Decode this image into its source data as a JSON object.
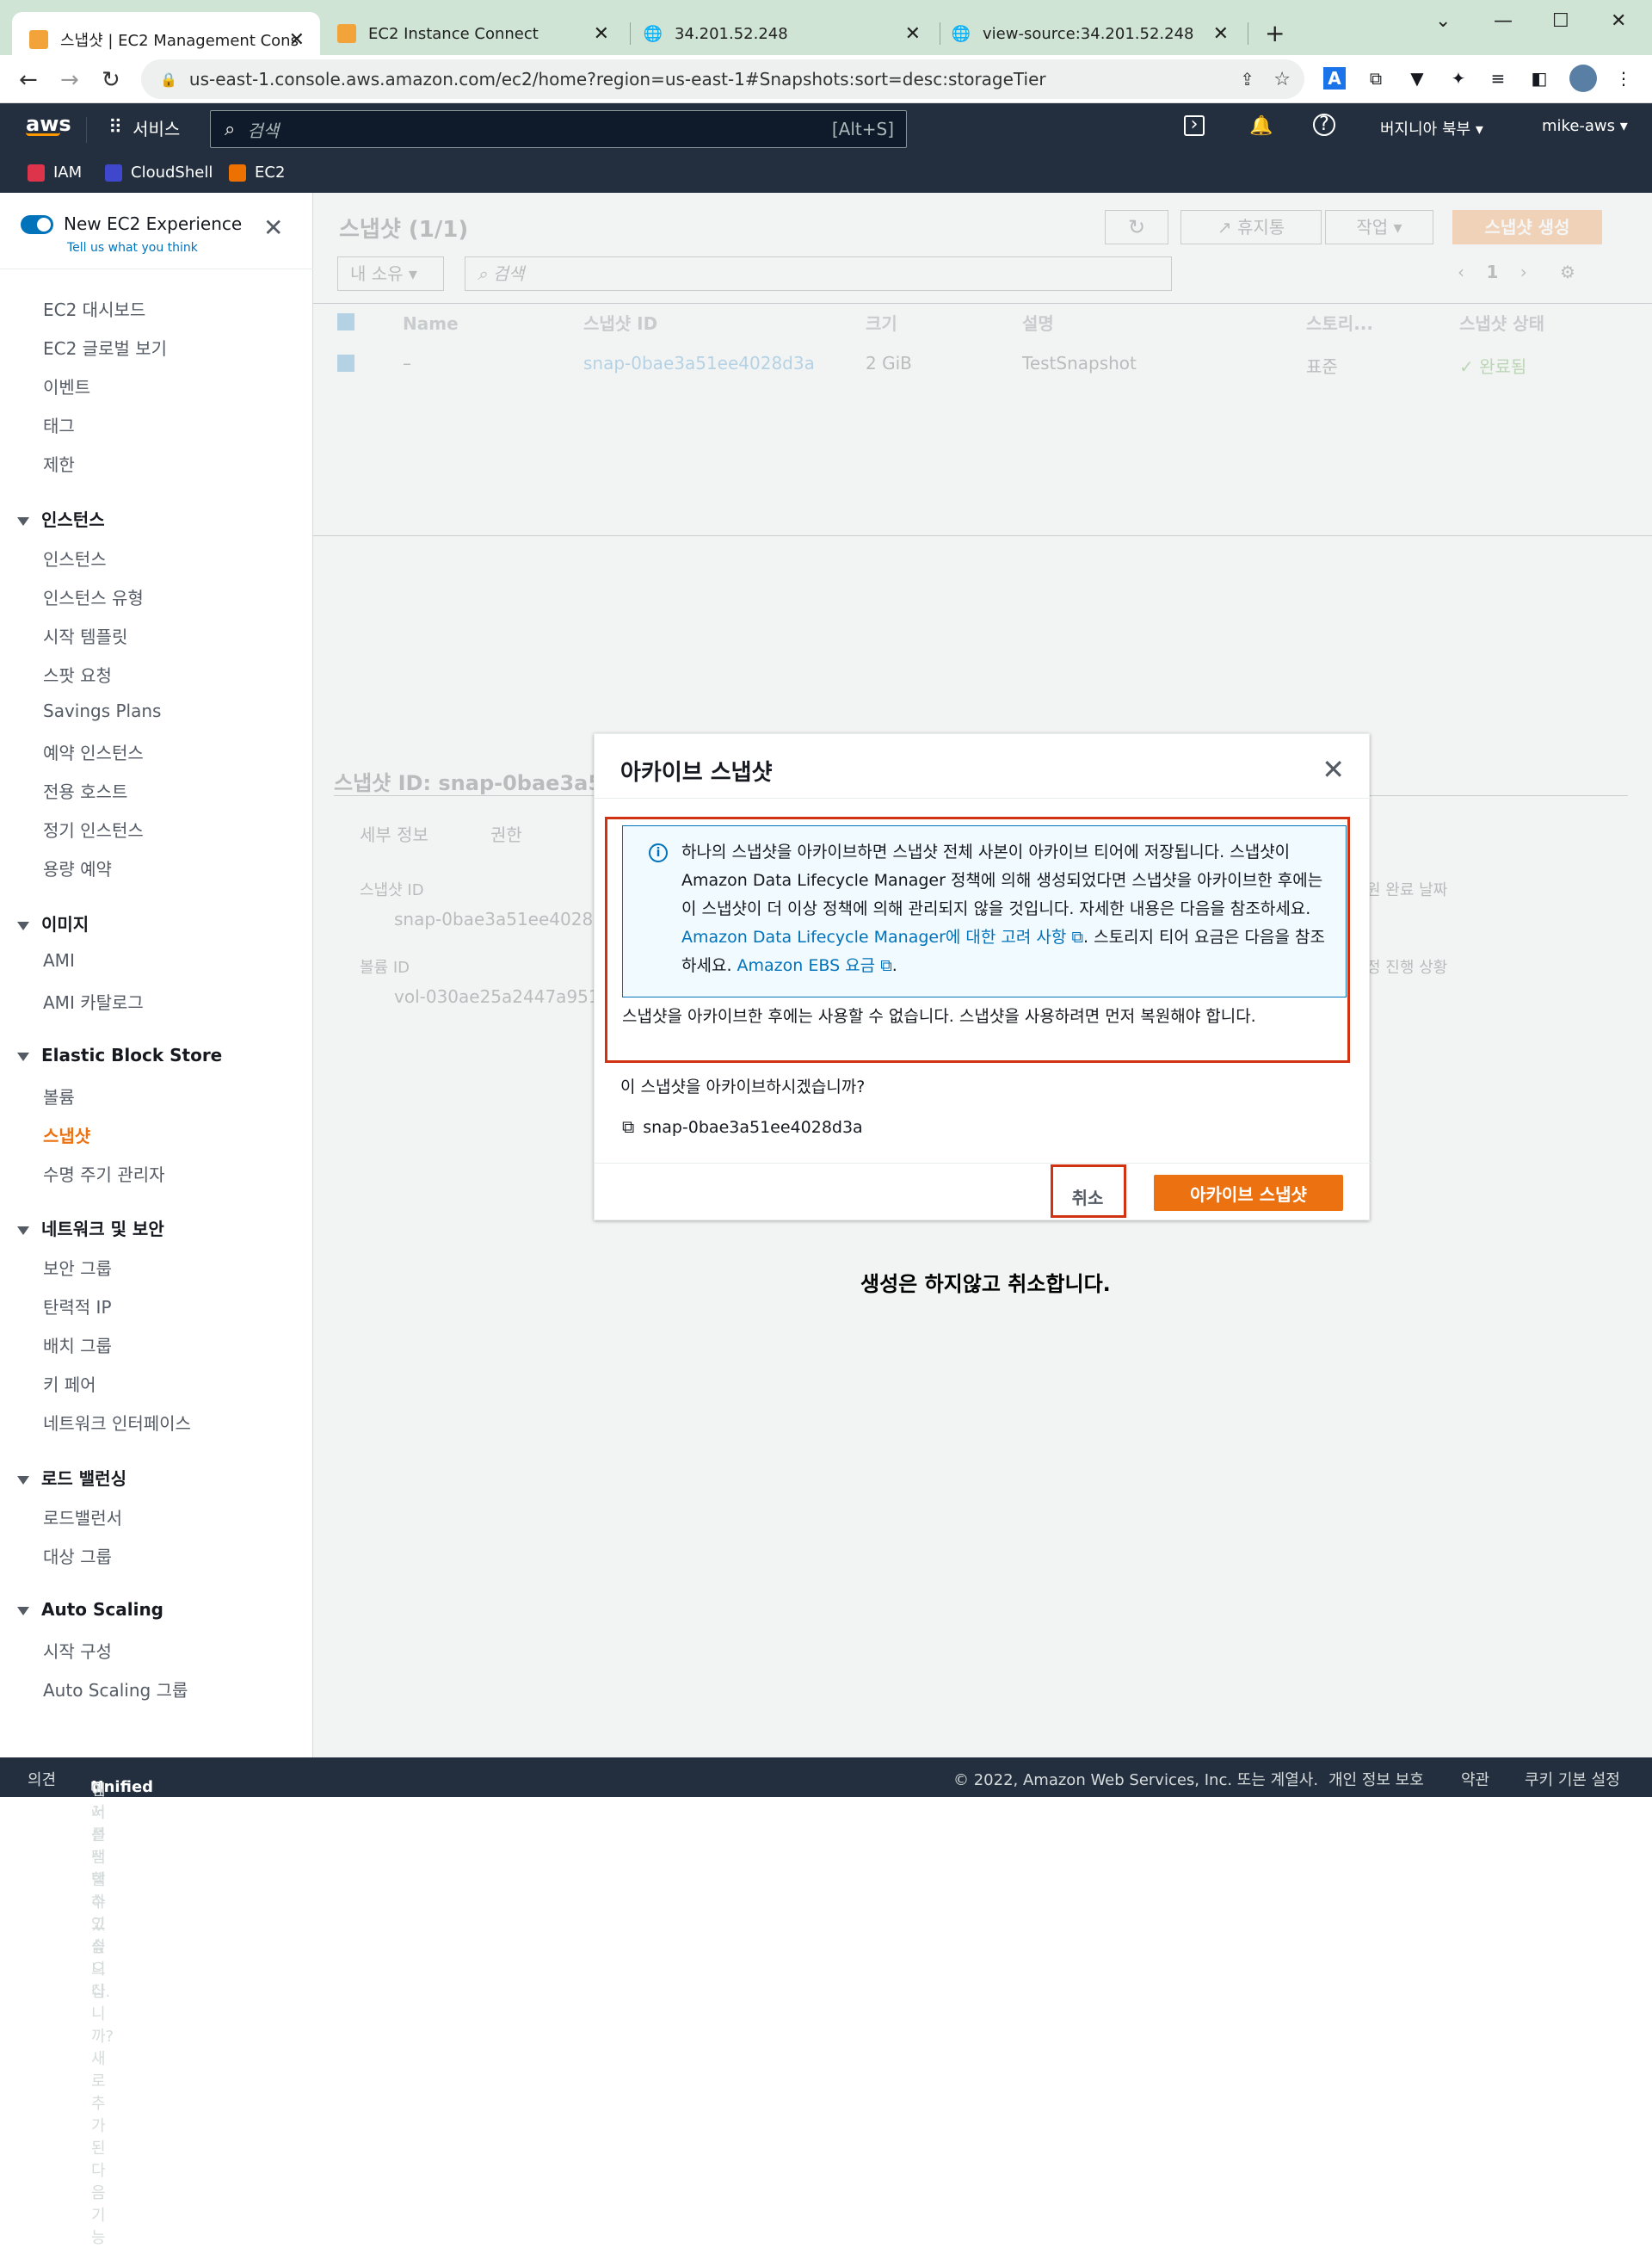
{
  "browser": {
    "tabs": [
      {
        "title": "스냅샷 | EC2 Management Cons",
        "active": true
      },
      {
        "title": "EC2 Instance Connect",
        "active": false
      },
      {
        "title": "34.201.52.248",
        "active": false
      },
      {
        "title": "view-source:34.201.52.248",
        "active": false
      }
    ],
    "url": "us-east-1.console.aws.amazon.com/ec2/home?region=us-east-1#Snapshots:sort=desc:storageTier"
  },
  "awsbar": {
    "logo": "aws",
    "services": "서비스",
    "search_placeholder": "검색",
    "search_shortcut": "[Alt+S]",
    "region": "버지니아 북부",
    "user": "mike-aws",
    "favorites": [
      "IAM",
      "CloudShell",
      "EC2"
    ]
  },
  "sidebar": {
    "new_exp_title": "New EC2 Experience",
    "new_exp_sub": "Tell us what you think",
    "top_items": [
      "EC2 대시보드",
      "EC2 글로벌 보기",
      "이벤트",
      "태그",
      "제한"
    ],
    "sections": [
      {
        "title": "인스턴스",
        "items": [
          "인스턴스",
          "인스턴스 유형",
          "시작 템플릿",
          "스팟 요청",
          "Savings Plans",
          "예약 인스턴스",
          "전용 호스트",
          "정기 인스턴스",
          "용량 예약"
        ]
      },
      {
        "title": "이미지",
        "items": [
          "AMI",
          "AMI 카탈로그"
        ]
      },
      {
        "title": "Elastic Block Store",
        "items": [
          "볼륨",
          "스냅샷",
          "수명 주기 관리자"
        ]
      },
      {
        "title": "네트워크 및 보안",
        "items": [
          "보안 그룹",
          "탄력적 IP",
          "배치 그룹",
          "키 페어",
          "네트워크 인터페이스"
        ]
      },
      {
        "title": "로드 밸런싱",
        "items": [
          "로드밸런서",
          "대상 그룹"
        ]
      },
      {
        "title": "Auto Scaling",
        "items": [
          "시작 구성",
          "Auto Scaling 그룹"
        ]
      }
    ],
    "active_item": "스냅샷"
  },
  "main": {
    "title": "스냅샷 (1/1)",
    "recycle_bin": "휴지통",
    "actions": "작업",
    "create": "스냅샷 생성",
    "filter_owner": "내 소유",
    "search_placeholder": "검색",
    "page": "1",
    "columns": [
      "Name",
      "스냅샷 ID",
      "크기",
      "설명",
      "스토리...",
      "스냅샷 상태"
    ],
    "row": [
      "–",
      "snap-0bae3a51ee4028d3a",
      "2 GiB",
      "TestSnapshot",
      "표준",
      "완료됨"
    ],
    "detail_title": "스냅샷 ID: snap-0bae3a51e",
    "detail_tabs": [
      "세부 정보",
      "권한"
    ],
    "detail_labels": [
      "스냅샷 ID",
      "볼륨 ID"
    ],
    "detail_values": [
      "snap-0bae3a51ee4028d",
      "vol-030ae25a2447a951"
    ],
    "detail_right": [
      "원 완료 날짜",
      "정 진행 상황"
    ]
  },
  "modal": {
    "title": "아카이브 스냅샷",
    "info_part1": "하나의 스냅샷을 아카이브하면 스냅샷 전체 사본이 아카이브 티어에 저장됩니다. 스냅샷이 Amazon Data Lifecycle Manager 정책에 의해 생성되었다면 스냅샷을 아카이브한 후에는 이 스냅샷이 더 이상 정책에 의해 관리되지 않을 것입니다. 자세한 내용은 다음을 참조하세요.",
    "info_link1": "Amazon Data Lifecycle Manager에 대한 고려 사항",
    "info_part2": ". 스토리지 티어 요금은 다음을 참조하세요.",
    "info_link2": "Amazon EBS 요금",
    "info_end": ".",
    "warning": "스냅샷을 아카이브한 후에는 사용할 수 없습니다. 스냅샷을 사용하려면 먼저 복원해야 합니다.",
    "question": "이 스냅샷을 아카이브하시겠습니까?",
    "snapshot_id": "snap-0bae3a51ee4028d3a",
    "cancel": "취소",
    "confirm": "아카이브 스냅샷"
  },
  "caption": "생성은 하지않고 취소합니다.",
  "footer": {
    "feedback": "의견",
    "lang_prefix": "언어를 선택하고 싶으십니까? 새로 추가된 다음 기능",
    "lang_link": "Unified Settings",
    "lang_suffix": "에서 선택할 수 있습니다.",
    "copyright": "© 2022, Amazon Web Services, Inc. 또는 계열사.",
    "privacy": "개인 정보 보호",
    "terms": "약관",
    "cookies": "쿠키 기본 설정"
  }
}
